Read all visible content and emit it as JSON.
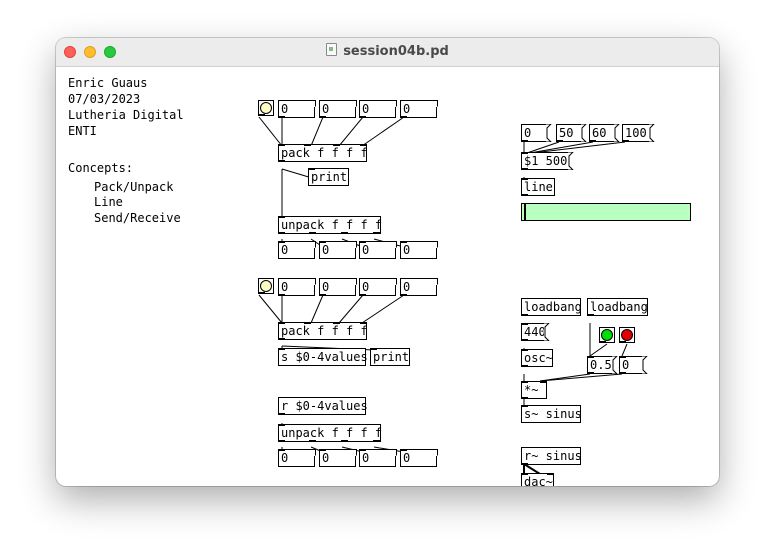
{
  "window": {
    "title": "session04b.pd"
  },
  "colors": {
    "bang_light": "#fcfcc4",
    "bang_green": "#00e000",
    "bang_red": "#e00000",
    "slider_fill": "#b8ffc0"
  },
  "comments": {
    "author": "Enric Guaus",
    "date": "07/03/2023",
    "org": "Lutheria Digital",
    "school": "ENTI",
    "concepts_title": "Concepts:",
    "concepts": [
      "Pack/Unpack",
      "Line",
      "Send/Receive"
    ]
  },
  "pack_demo": {
    "numbers_in": [
      "0",
      "0",
      "0",
      "0"
    ],
    "pack": "pack f f f f",
    "print": "print",
    "unpack": "unpack f f f f",
    "numbers_out": [
      "0",
      "0",
      "0",
      "0"
    ]
  },
  "send_demo": {
    "numbers_in": [
      "0",
      "0",
      "0",
      "0"
    ],
    "pack": "pack f f f f",
    "send": "s $0-4values",
    "print": "print",
    "receive": "r $0-4values",
    "unpack": "unpack f f f f",
    "numbers_out": [
      "0",
      "0",
      "0",
      "0"
    ]
  },
  "line_demo": {
    "messages": [
      "0",
      "50",
      "60",
      "100"
    ],
    "msg_ramp": "$1 500",
    "line": "line",
    "slider_value": 0
  },
  "osc_demo": {
    "loadbang_1": "loadbang",
    "loadbang_2": "loadbang",
    "freq": "440",
    "osc": "osc~",
    "gain_msg": "0.5",
    "gain_zero": "0",
    "mul": "*~",
    "send": "s~ sinus",
    "receive": "r~ sinus",
    "dac": "dac~"
  }
}
